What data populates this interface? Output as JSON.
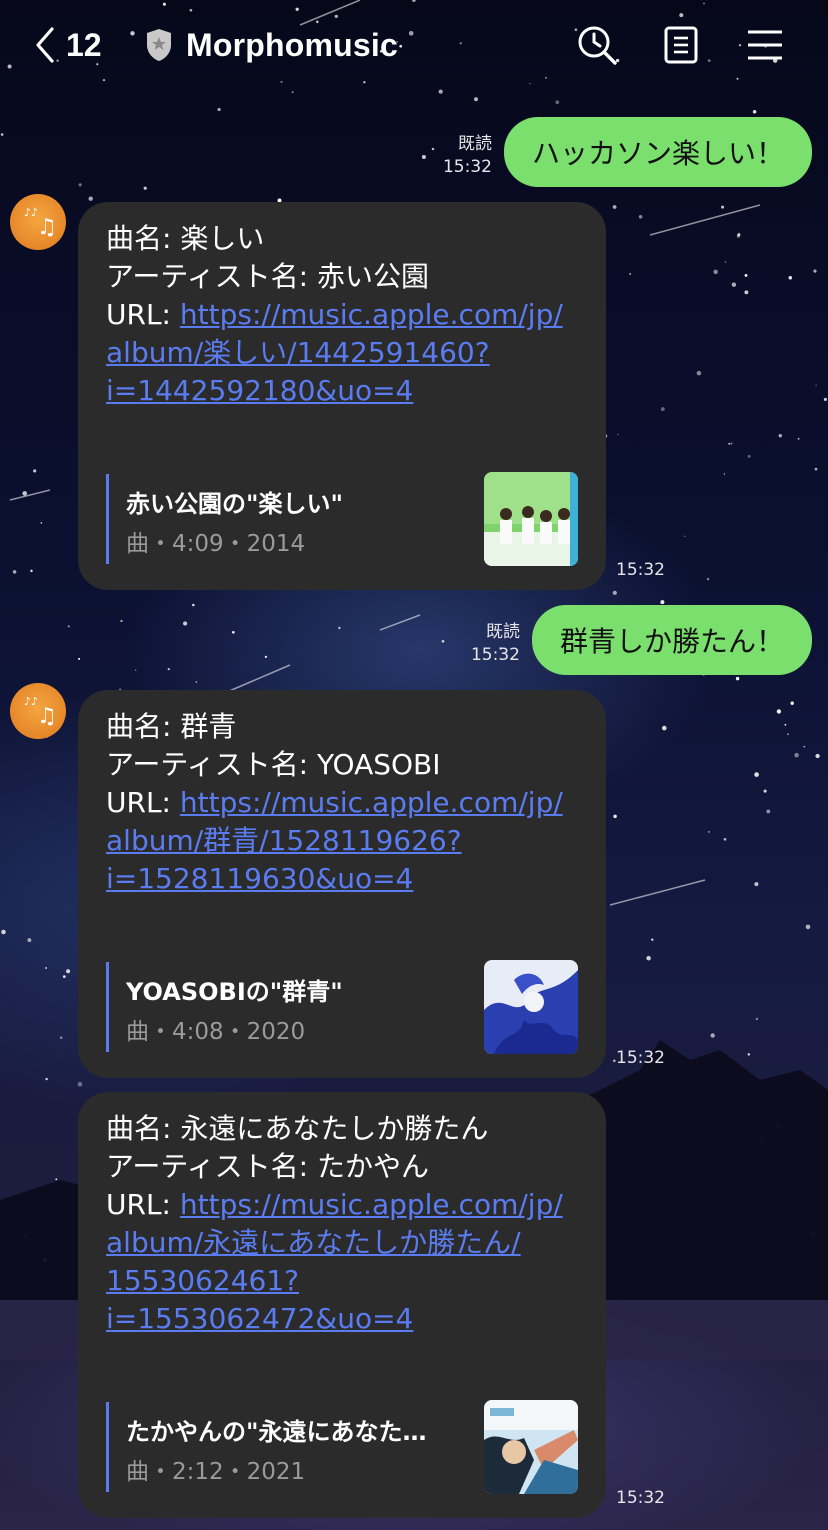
{
  "header": {
    "back_count": "12",
    "title": "Morphomusic"
  },
  "messages": [
    {
      "type": "sent",
      "read_label": "既読",
      "time": "15:32",
      "text": "ハッカソン楽しい！"
    },
    {
      "type": "received",
      "time": "15:32",
      "lines": [
        "曲名: 楽しい",
        "アーティスト名: 赤い公園"
      ],
      "url_prefix": "URL: ",
      "url_lines": [
        "https://music.apple.com/jp/",
        "album/楽しい/1442591460?",
        "i=1442592180&uo=4"
      ],
      "preview": {
        "title": "赤い公園の\"楽しい\"",
        "subtitle": "曲・4:09・2014"
      }
    },
    {
      "type": "sent",
      "read_label": "既読",
      "time": "15:32",
      "text": "群青しか勝たん！"
    },
    {
      "type": "received",
      "time": "15:32",
      "lines": [
        "曲名: 群青",
        "アーティスト名: YOASOBI"
      ],
      "url_prefix": "URL: ",
      "url_lines": [
        "https://music.apple.com/jp/",
        "album/群青/1528119626?",
        "i=1528119630&uo=4"
      ],
      "preview": {
        "title": "YOASOBIの\"群青\"",
        "subtitle": "曲・4:08・2020"
      }
    },
    {
      "type": "received",
      "time": "15:32",
      "lines": [
        "曲名: 永遠にあなたしか勝たん",
        "アーティスト名: たかやん"
      ],
      "url_prefix": "URL: ",
      "url_lines": [
        "https://music.apple.com/jp/",
        "album/永遠にあなたしか勝たん/",
        "1553062461?",
        "i=1553062472&uo=4"
      ],
      "preview": {
        "title": "たかやんの\"永遠にあなた…",
        "subtitle": "曲・2:12・2021"
      }
    }
  ],
  "colors": {
    "sent_bubble": "#7adf6d",
    "received_bubble": "#2b2b2b",
    "link": "#5b7cf0"
  },
  "icons": [
    "chevron-left-icon",
    "shield-icon",
    "search-icon",
    "notes-icon",
    "menu-icon"
  ]
}
